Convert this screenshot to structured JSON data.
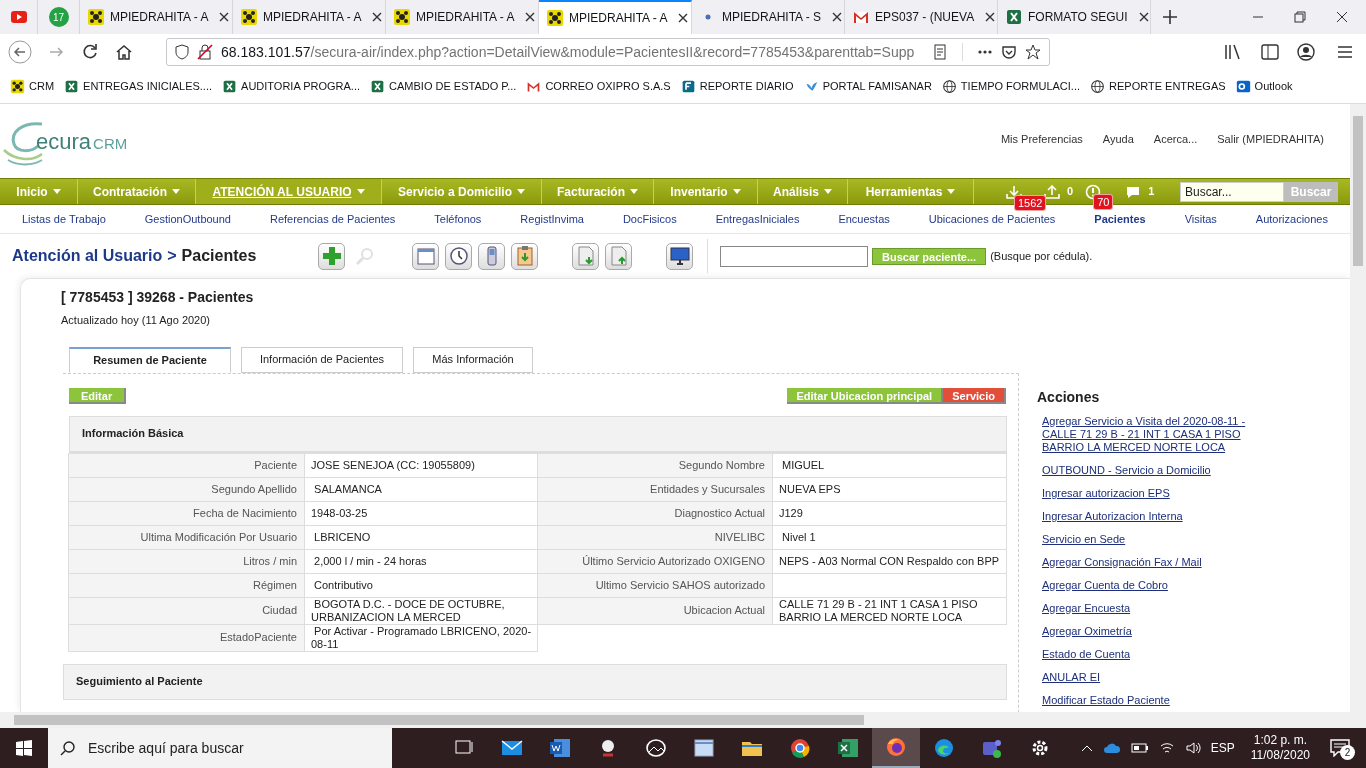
{
  "browser": {
    "tabs": [
      {
        "kind": "youtube",
        "selected": false
      },
      {
        "kind": "chat",
        "title": "17",
        "selected": false
      },
      {
        "kind": "crm",
        "title": "MPIEDRAHITA - A",
        "selected": false
      },
      {
        "kind": "crm",
        "title": "MPIEDRAHITA - A",
        "selected": false
      },
      {
        "kind": "crm",
        "title": "MPIEDRAHITA - A",
        "selected": false
      },
      {
        "kind": "crm",
        "title": "MPIEDRAHITA - A",
        "selected": true
      },
      {
        "kind": "dot",
        "title": "MPIEDRAHITA - S",
        "selected": false
      },
      {
        "kind": "mail",
        "title": "EPS037 - (NUEVA",
        "selected": false
      },
      {
        "kind": "sheet",
        "title": "FORMATO SEGUI",
        "selected": false
      }
    ],
    "url_host": "68.183.101.57",
    "url_path": "/secura-air/index.php?action=DetailView&module=PacientesII&record=7785453&parenttab=Supp",
    "bookmarks": [
      {
        "kind": "crm",
        "label": "CRM"
      },
      {
        "kind": "sheet",
        "label": "ENTREGAS INICIALES...."
      },
      {
        "kind": "sheet",
        "label": "AUDITORIA PROGRA..."
      },
      {
        "kind": "sheet",
        "label": "CAMBIO DE ESTADO P..."
      },
      {
        "kind": "mail",
        "label": "CORREO OXIPRO S.A.S"
      },
      {
        "kind": "form",
        "label": "REPORTE DIARIO"
      },
      {
        "kind": "bird",
        "label": "PORTAL FAMISANAR"
      },
      {
        "kind": "globe",
        "label": "TIEMPO FORMULACI..."
      },
      {
        "kind": "globe",
        "label": "REPORTE ENTREGAS"
      },
      {
        "kind": "outlook",
        "label": "Outlook"
      }
    ]
  },
  "app": {
    "logo_main": "ecura",
    "logo_suffix": "CRM",
    "header_links": [
      "Mis Preferencias",
      "Ayuda",
      "Acerca...",
      "Salir (MPIEDRAHITA)"
    ],
    "menu": [
      {
        "label": "Inicio",
        "selected": false
      },
      {
        "label": "Contratación",
        "selected": false
      },
      {
        "label": "ATENCIÓN AL USUARIO",
        "selected": true
      },
      {
        "label": "Servicio a Domicilio",
        "selected": false
      },
      {
        "label": "Facturación",
        "selected": false
      },
      {
        "label": "Inventario",
        "selected": false
      },
      {
        "label": "Análisis",
        "selected": false
      },
      {
        "label": "Herramientas",
        "selected": false
      }
    ],
    "notifications": [
      {
        "badge": "1562",
        "count": "0"
      },
      {
        "badge": "70",
        "count": "1"
      }
    ],
    "search": {
      "placeholder": "Buscar...",
      "button": "Buscar"
    },
    "submenu": [
      {
        "label": "Listas de Trabajo",
        "selected": false
      },
      {
        "label": "GestionOutbound",
        "selected": false
      },
      {
        "label": "Referencias de Pacientes",
        "selected": false
      },
      {
        "label": "Teléfonos",
        "selected": false
      },
      {
        "label": "RegistInvima",
        "selected": false
      },
      {
        "label": "DocFisicos",
        "selected": false
      },
      {
        "label": "EntregasIniciales",
        "selected": false
      },
      {
        "label": "Encuestas",
        "selected": false
      },
      {
        "label": "Ubicaciones de Pacientes",
        "selected": false
      },
      {
        "label": "Pacientes",
        "selected": true
      },
      {
        "label": "Visitas",
        "selected": false
      },
      {
        "label": "Autorizaciones",
        "selected": false
      }
    ]
  },
  "page": {
    "breadcrumb_module": "Atención al Usuario",
    "breadcrumb_sep": ">",
    "breadcrumb_page": "Pacientes",
    "toolbar_tools": [
      {
        "disabled": false
      },
      {
        "disabled": true
      },
      {
        "disabled": false
      },
      {
        "disabled": false
      },
      {
        "disabled": false
      },
      {
        "disabled": false
      },
      {
        "disabled": false
      },
      {
        "disabled": false
      },
      {
        "disabled": false
      }
    ],
    "patient_search_button": "Buscar paciente...",
    "patient_search_hint": "(Busque por cédula).",
    "record_title": "[ 7785453 ] 39268 - Pacientes",
    "updated": "Actualizado hoy (11 Ago 2020)",
    "tabs": [
      {
        "label": "Resumen de Paciente",
        "selected": true
      },
      {
        "label": "Información de Pacientes",
        "selected": false
      },
      {
        "label": "Más Información",
        "selected": false
      }
    ],
    "edit_button": "Editar",
    "edit_location_button": "Editar Ubicacion principal",
    "service_button": "Servicio",
    "section_title": "Información Básica",
    "fields": [
      {
        "label": "Paciente",
        "value": "JOSE SENEJOA (CC: 19055809)",
        "label_2": "Segundo Nombre",
        "value_2": " MIGUEL"
      },
      {
        "label": "Segundo Apellido",
        "value": " SALAMANCA",
        "label_2": "Entidades y Sucursales",
        "value_2": "NUEVA EPS"
      },
      {
        "label": "Fecha de Nacimiento",
        "value": "1948-03-25",
        "label_2": "Diagnostico Actual",
        "value_2": "J129"
      },
      {
        "label": "Ultima Modificación Por Usuario",
        "value": " LBRICENO",
        "label_2": "NIVELIBC",
        "value_2": " Nivel 1"
      },
      {
        "label": "Litros / min",
        "value": " 2,000 l / min - 24 horas",
        "label_2": "Último Servicio Autorizado OXIGENO",
        "value_2": "NEPS - A03 Normal CON Respaldo con BPP"
      },
      {
        "label": "Régimen",
        "value": " Contributivo",
        "label_2": "Ultimo Servicio SAHOS autorizado"
      },
      {
        "label": "Ciudad",
        "value": " BOGOTA D.C. - DOCE DE OCTUBRE, URBANIZACION LA MERCED",
        "label_2": "Ubicacion Actual",
        "value_2": "CALLE 71 29 B - 21 INT 1 CASA 1 PISO BARRIO LA MERCED NORTE LOCA"
      },
      {
        "label": "EstadoPaciente",
        "value": " Por Activar - Programado LBRICENO, 2020-08-11"
      }
    ],
    "section_2_title": "Seguimiento al Paciente",
    "actions_title": "Acciones",
    "actions": [
      "Agregar Servicio a Visita del 2020-08-11 - CALLE 71 29 B - 21 INT 1 CASA 1 PISO BARRIO LA MERCED NORTE LOCA",
      "OUTBOUND - Servicio a Domicilio",
      "Ingresar autorizacion EPS",
      "Ingresar Autorizacion Interna",
      "Servicio en Sede",
      "Agregar Consignación Fax / Mail",
      "Agregar Cuenta de Cobro",
      "Agregar Encuesta",
      "Agregar Oximetría",
      "Estado de Cuenta",
      "ANULAR EI",
      "Modificar Estado Paciente"
    ]
  },
  "taskbar": {
    "search_placeholder": "Escribe aquí para buscar",
    "apps": [
      {
        "selected": false
      },
      {
        "selected": false
      },
      {
        "selected": false
      },
      {
        "selected": false
      },
      {
        "selected": false
      },
      {
        "selected": false
      },
      {
        "selected": false
      },
      {
        "selected": false
      },
      {
        "selected": false
      },
      {
        "selected": true
      },
      {
        "selected": false
      },
      {
        "selected": false
      },
      {
        "selected": false
      }
    ],
    "language": "ESP",
    "time": "1:02 p. m.",
    "date": "11/08/2020",
    "notification_count": "2"
  }
}
